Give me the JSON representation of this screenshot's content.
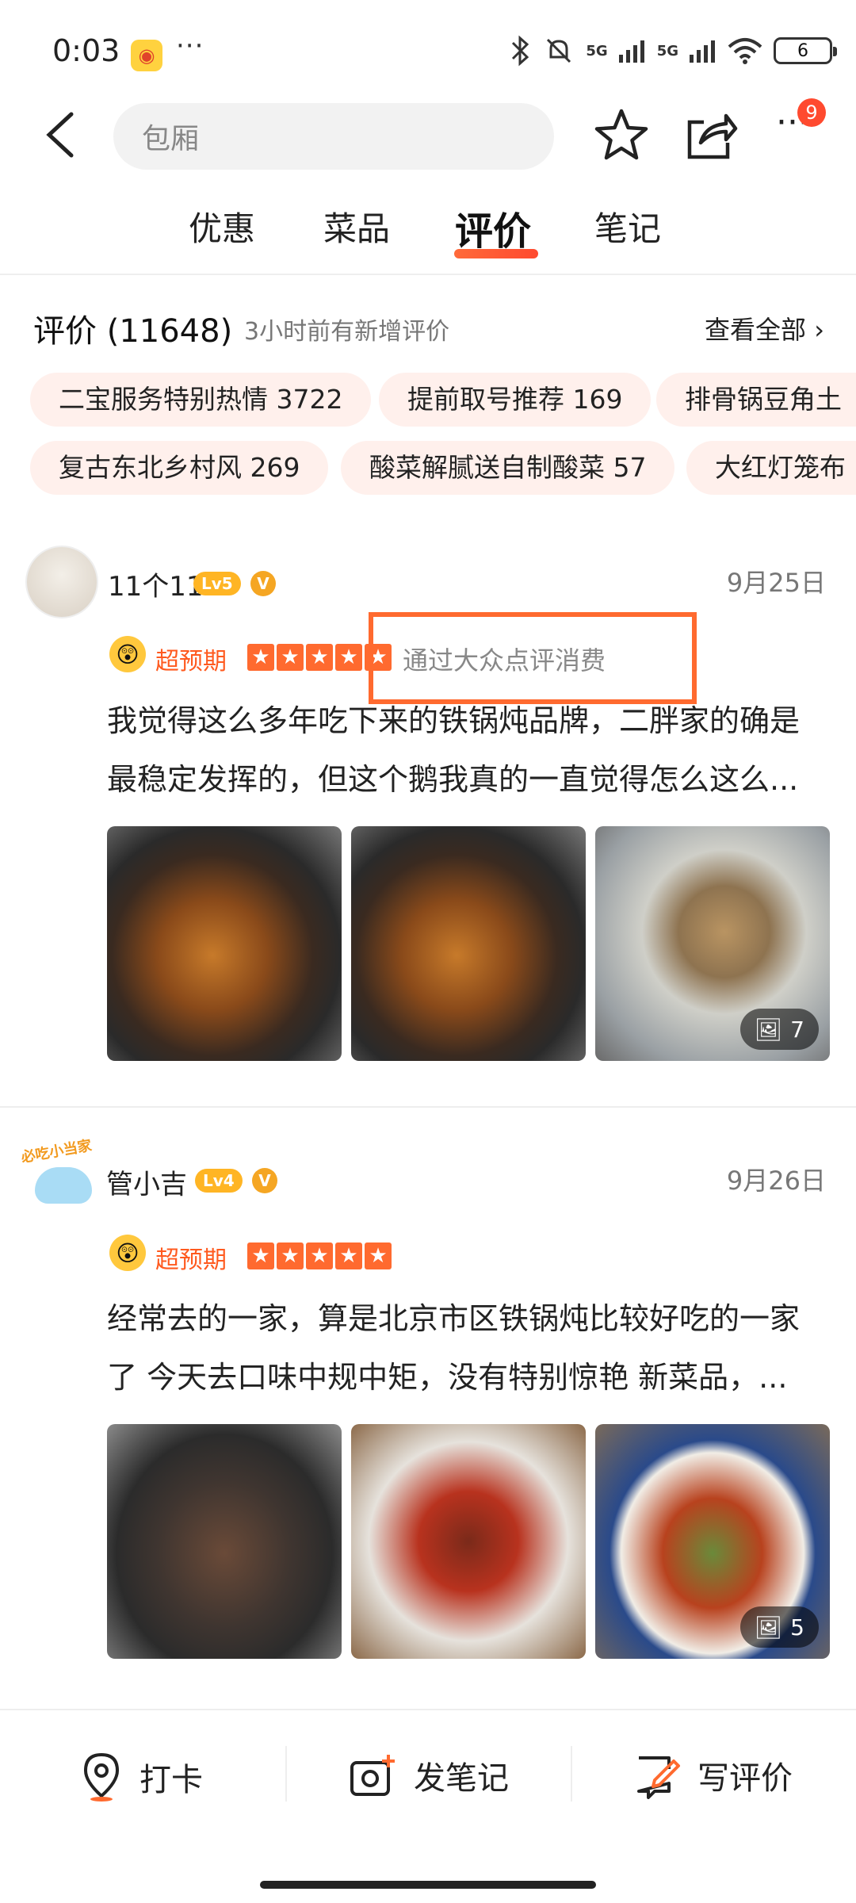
{
  "status": {
    "time": "0:03",
    "dots": "···",
    "signal1": "5G",
    "signal2": "5G",
    "battery": "6"
  },
  "header": {
    "search_placeholder": "包厢",
    "notif_count": "9",
    "more": "···"
  },
  "tabs": [
    "优惠",
    "菜品",
    "评价",
    "笔记"
  ],
  "active_tab": "评价",
  "reviews_header": {
    "title": "评价 (11648)",
    "subtitle": "3小时前有新增评价",
    "view_all": "查看全部"
  },
  "tags_row1": [
    "二宝服务特别热情 3722",
    "提前取号推荐 169",
    "排骨锅豆角土"
  ],
  "tags_row2": [
    "复古东北乡村风 269",
    "酸菜解腻送自制酸菜 57",
    "大红灯笼布"
  ],
  "reviews": [
    {
      "user": "11个11",
      "level": "Lv5",
      "v": "V",
      "date": "9月25日",
      "expect": "超预期",
      "stars": 5,
      "via": "通过大众点评消费",
      "text1": "我觉得这么多年吃下来的铁锅炖品牌，二胖家的确是",
      "text2": "最稳定发挥的，但这个鹅我真的一直觉得怎么这么...",
      "photo_count": "7"
    },
    {
      "user": "管小吉",
      "level": "Lv4",
      "v": "V",
      "date": "9月26日",
      "expect": "超预期",
      "stars": 5,
      "avatar_label": "必吃小当家",
      "text1": "经常去的一家，算是北京市区铁锅炖比较好吃的一家",
      "text2": "了 今天去口味中规中矩，没有特别惊艳 新菜品，...",
      "photo_count": "5"
    }
  ],
  "bottom": {
    "checkin": "打卡",
    "note": "发笔记",
    "review": "写评价"
  },
  "colors": {
    "accent": "#ff6a2f",
    "tag_bg": "#fff0ec",
    "level": "#ffb524"
  }
}
